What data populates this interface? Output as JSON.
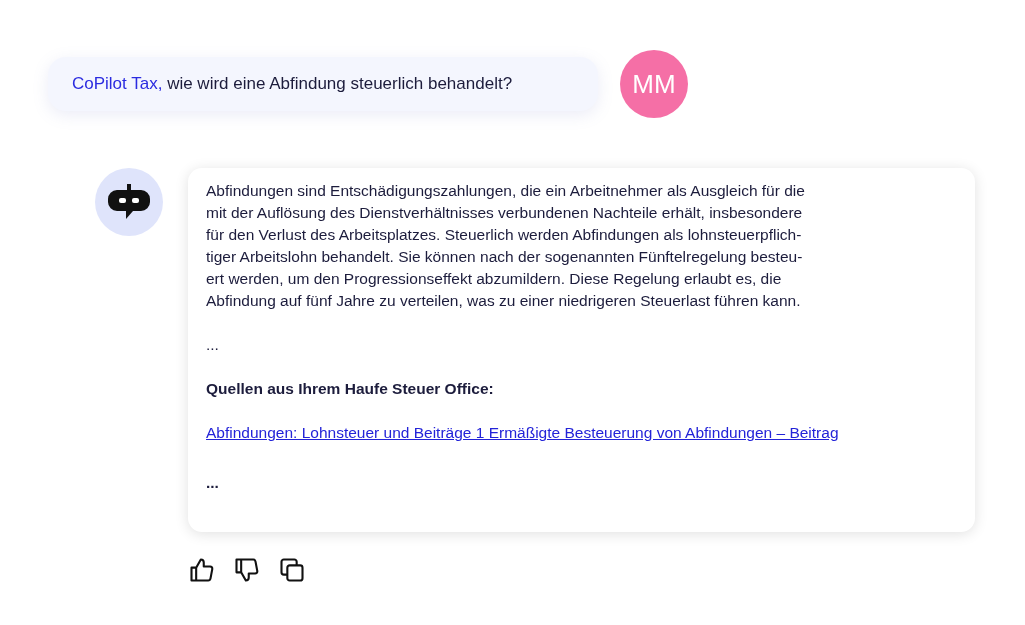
{
  "user_message": {
    "addressee": "CoPilot Tax,",
    "text": "wie wird eine Abfindung steuerlich behandelt?",
    "avatar_initials": "MM"
  },
  "answer": {
    "paragraph_lines": [
      "Abfindungen sind Entschädigungszahlungen, die ein Arbeitnehmer als Ausgleich für die",
      "mit der Auflösung des Dienstverhältnisses verbundenen Nachteile erhält, insbesondere",
      "für den Verlust des Arbeitsplatzes. Steuerlich werden Abfindungen als lohnsteuerpflich-",
      "tiger Arbeitslohn behandelt. Sie können nach der sogenannten Fünftelregelung besteu-",
      "ert werden, um den Progressionseffekt abzumildern. Diese Regelung erlaubt es, die",
      "Abfindung auf fünf Jahre zu verteilen, was zu einer niedrigeren Steuerlast führen kann."
    ],
    "ellipsis_1": "...",
    "sources_heading": "Quellen aus Ihrem Haufe Steuer Office:",
    "source_link": "Abfindungen: Lohnsteuer und Beiträge 1 Ermäßigte Besteuerung von Abfindungen – Beitrag",
    "ellipsis_2": "..."
  },
  "actions": [
    {
      "kind": "like"
    },
    {
      "kind": "dislike"
    },
    {
      "kind": "copy"
    }
  ]
}
